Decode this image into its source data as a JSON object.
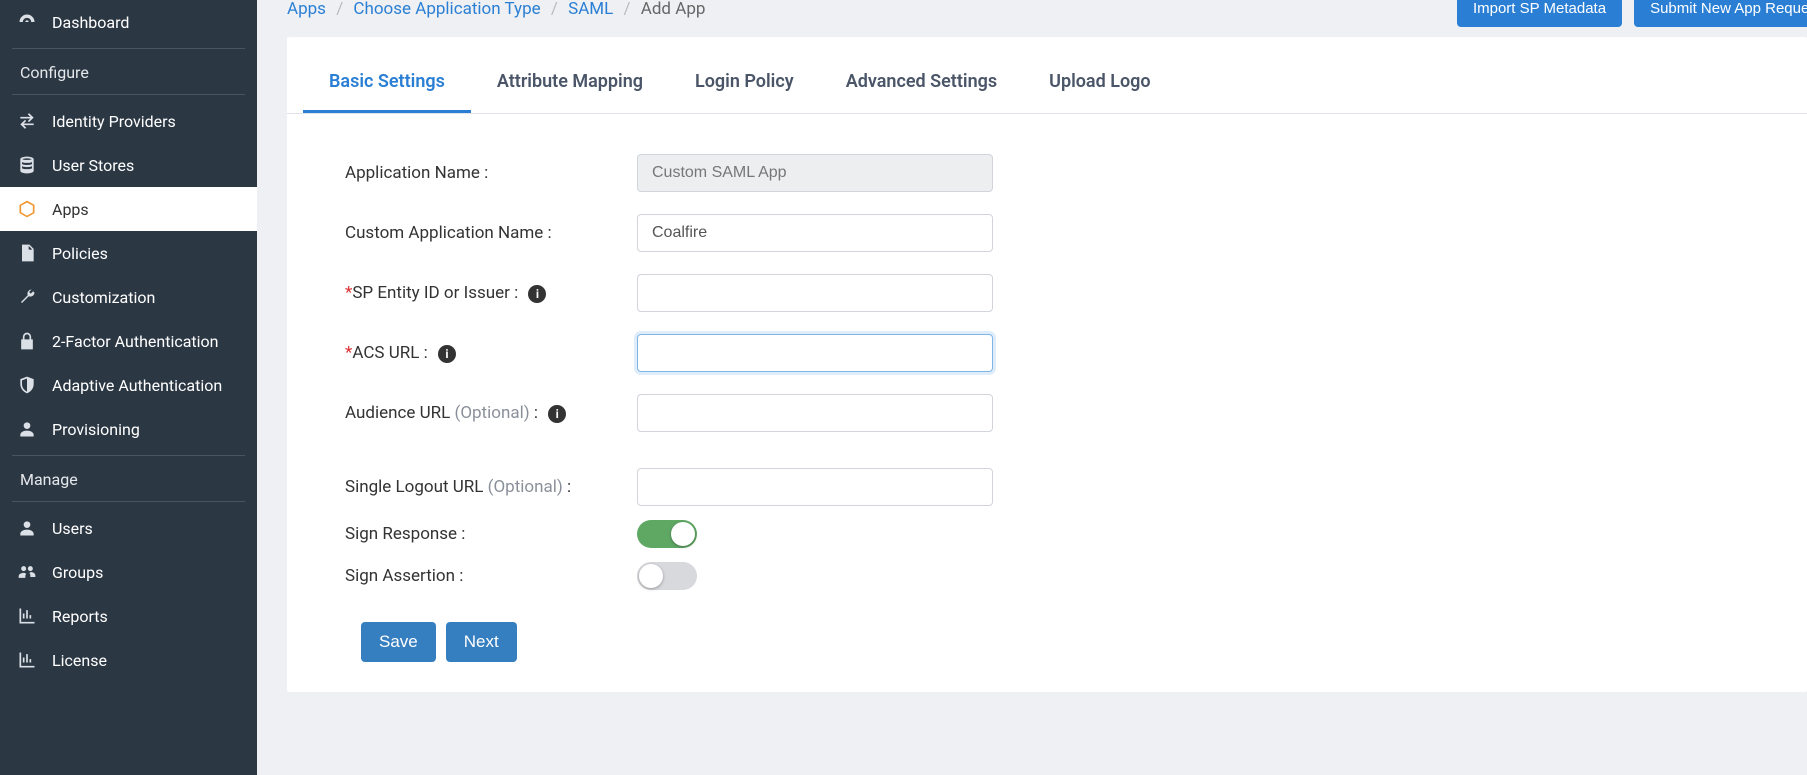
{
  "sidebar": {
    "items": [
      {
        "id": "dashboard",
        "label": "Dashboard",
        "icon": "dashboard"
      },
      {
        "id": "section-configure",
        "label": "Configure",
        "section": true
      },
      {
        "id": "idp",
        "label": "Identity Providers",
        "icon": "swap"
      },
      {
        "id": "userstores",
        "label": "User Stores",
        "icon": "database"
      },
      {
        "id": "apps",
        "label": "Apps",
        "icon": "cube",
        "active": true
      },
      {
        "id": "policies",
        "label": "Policies",
        "icon": "document"
      },
      {
        "id": "customization",
        "label": "Customization",
        "icon": "wrench"
      },
      {
        "id": "twofactor",
        "label": "2-Factor Authentication",
        "icon": "lock"
      },
      {
        "id": "adaptive",
        "label": "Adaptive Authentication",
        "icon": "shield"
      },
      {
        "id": "provisioning",
        "label": "Provisioning",
        "icon": "person"
      },
      {
        "id": "section-manage",
        "label": "Manage",
        "section": true
      },
      {
        "id": "users",
        "label": "Users",
        "icon": "person"
      },
      {
        "id": "groups",
        "label": "Groups",
        "icon": "people"
      },
      {
        "id": "reports",
        "label": "Reports",
        "icon": "chart"
      },
      {
        "id": "license",
        "label": "License",
        "icon": "chart"
      }
    ]
  },
  "breadcrumb": {
    "apps": "Apps",
    "choose": "Choose Application Type",
    "saml": "SAML",
    "add": "Add App"
  },
  "header_buttons": {
    "import": "Import SP Metadata",
    "submit": "Submit New App Request"
  },
  "tabs": {
    "basic": "Basic Settings",
    "attr": "Attribute Mapping",
    "login": "Login Policy",
    "adv": "Advanced Settings",
    "logo": "Upload Logo"
  },
  "form": {
    "app_name_label": "Application Name :",
    "app_name_value": "Custom SAML App",
    "custom_name_label": "Custom Application Name :",
    "custom_name_value": "Coalfire",
    "sp_entity_label": "SP Entity ID or Issuer :",
    "sp_entity_value": "",
    "acs_label": "ACS URL :",
    "acs_value": "",
    "audience_label": "Audience URL ",
    "audience_opt": "(Optional)",
    "audience_colon": " :",
    "audience_value": "",
    "slo_label": "Single Logout URL ",
    "slo_opt": "(Optional)",
    "slo_colon": " :",
    "slo_value": "",
    "sign_response_label": "Sign Response :",
    "sign_response_on": true,
    "sign_assertion_label": "Sign Assertion :",
    "sign_assertion_on": false,
    "save": "Save",
    "next": "Next",
    "required_mark": "*"
  }
}
